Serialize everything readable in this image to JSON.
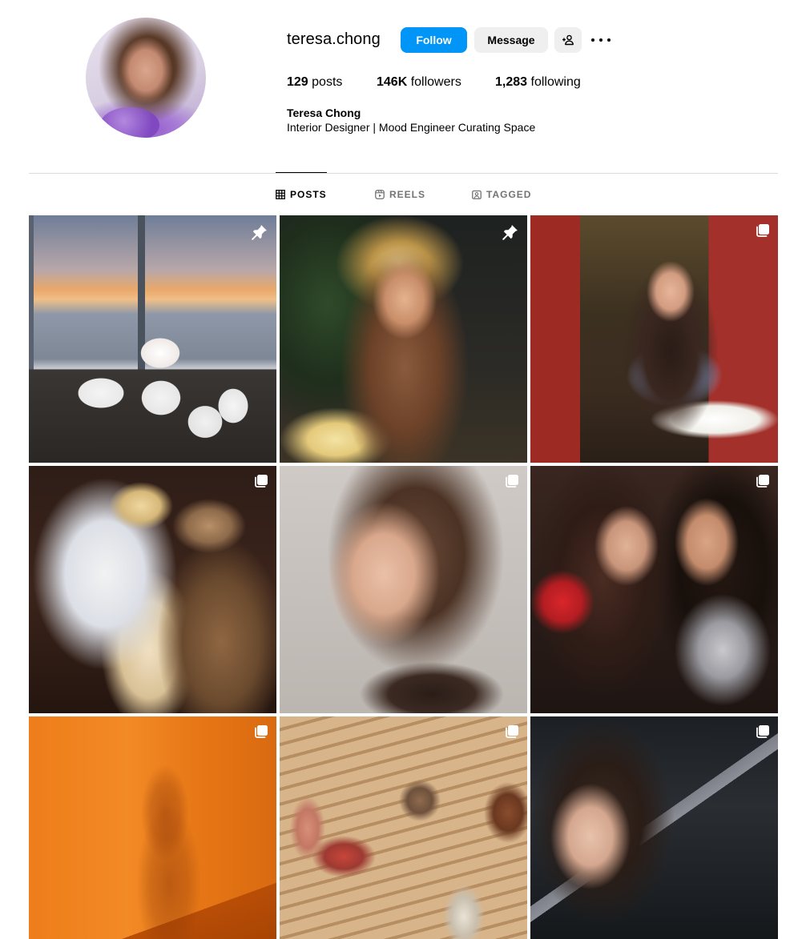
{
  "profile": {
    "username": "teresa.chong",
    "follow_label": "Follow",
    "message_label": "Message",
    "stats": {
      "posts_count": "129",
      "posts_label": "posts",
      "followers_count": "146K",
      "followers_label": "followers",
      "following_count": "1,283",
      "following_label": "following"
    },
    "full_name": "Teresa Chong",
    "bio": "Interior Designer | Mood Engineer Curating Space"
  },
  "tabs": [
    {
      "label": "POSTS",
      "icon": "grid-icon",
      "active": true
    },
    {
      "label": "REELS",
      "icon": "reels-icon",
      "active": false
    },
    {
      "label": "TAGGED",
      "icon": "tagged-icon",
      "active": false
    }
  ],
  "posts": [
    {
      "badge": "pinned-icon"
    },
    {
      "badge": "pinned-icon"
    },
    {
      "badge": "carousel-icon"
    },
    {
      "badge": "carousel-icon"
    },
    {
      "badge": "carousel-icon"
    },
    {
      "badge": "carousel-icon"
    },
    {
      "badge": "carousel-icon"
    },
    {
      "badge": "carousel-icon"
    },
    {
      "badge": "carousel-icon"
    }
  ],
  "colors": {
    "follow_button": "#0095f6",
    "secondary_button": "#efefef",
    "divider": "#dbdbdb",
    "inactive_tab": "#737373"
  }
}
